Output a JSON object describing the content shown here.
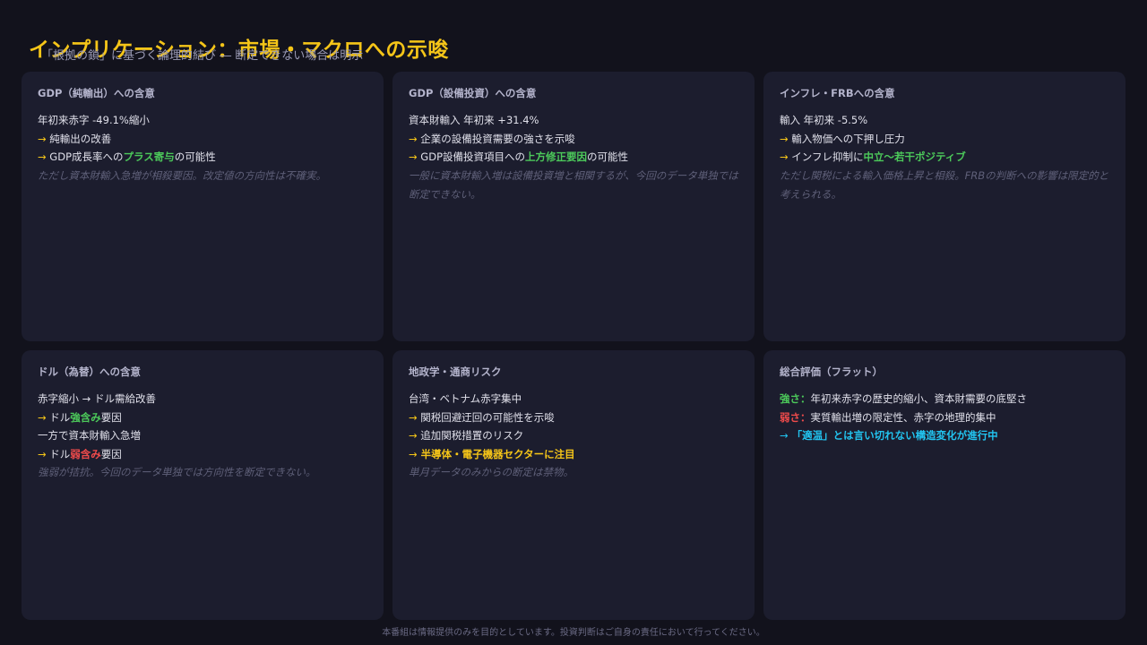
{
  "header": {
    "title": "インプリケーション：市場・マクロへの示唆",
    "subtitle": "「根拠の鎖」に基づく論理的結び ― 断定できない場合は明示"
  },
  "colors": {
    "accent_yellow": "#f5c518",
    "positive_green": "#4cc95a",
    "negative_red": "#f04b4b",
    "highlight_cyan": "#22c4f0",
    "card_bg": "#1c1d2e",
    "page_bg": "#12121c"
  },
  "cards": {
    "gdp_net_exports": {
      "title": "GDP（純輸出）への含意",
      "l1": "年初来赤字 -49.1%縮小",
      "arrow": "→",
      "l2": " 純輸出の改善",
      "l3_pre": " GDP成長率への",
      "l3_hl": "プラス寄与",
      "l3_post": "の可能性",
      "note": "ただし資本財輸入急増が相殺要因。改定値の方向性は不確実。"
    },
    "gdp_capex": {
      "title": "GDP（設備投資）への含意",
      "l1": "資本財輸入 年初来 +31.4%",
      "arrow": "→",
      "l2": " 企業の設備投資需要の強さを示唆",
      "l3_pre": " GDP設備投資項目への",
      "l3_hl": "上方修正要因",
      "l3_post": "の可能性",
      "note": "一般に資本財輸入増は設備投資増と相関するが、今回のデータ単独では断定できない。"
    },
    "inflation_frb": {
      "title": "インフレ・FRBへの含意",
      "l1": "輸入 年初来 -5.5%",
      "arrow": "→",
      "l2": " 輸入物価への下押し圧力",
      "l3_pre": " インフレ抑制に",
      "l3_hl": "中立〜若干ポジティブ",
      "note": "ただし関税による輸入価格上昇と相殺。FRBの判断への影響は限定的と考えられる。"
    },
    "dollar_fx": {
      "title": "ドル（為替）への含意",
      "l1": "赤字縮小 → ドル需給改善",
      "arrow": "→",
      "l2_pre": " ドル",
      "l2_hl": "強含み",
      "l2_post": "要因",
      "l3": "一方で資本財輸入急増",
      "l4_pre": " ドル",
      "l4_hl": "弱含み",
      "l4_post": "要因",
      "note": "強弱が拮抗。今回のデータ単独では方向性を断定できない。"
    },
    "geopolitics": {
      "title": "地政学・通商リスク",
      "l1": "台湾・ベトナム赤字集中",
      "arrow": "→",
      "l2": " 関税回避迂回の可能性を示唆",
      "l3": " 追加関税措置のリスク",
      "l4_hl": " 半導体・電子機器セクターに注目",
      "note": "単月データのみからの断定は禁物。"
    },
    "overall": {
      "title": "総合評価（フラット）",
      "strength_label": "強さ：",
      "strength_text": "年初来赤字の歴史的縮小、資本財需要の底堅さ",
      "weakness_label": "弱さ：",
      "weakness_text": "実質輸出増の限定性、赤字の地理的集中",
      "arrow": "→",
      "conclusion": " 「適温」とは言い切れない構造変化が進行中"
    }
  },
  "footer": {
    "disclaimer": "本番組は情報提供のみを目的としています。投資判断はご自身の責任において行ってください。"
  }
}
